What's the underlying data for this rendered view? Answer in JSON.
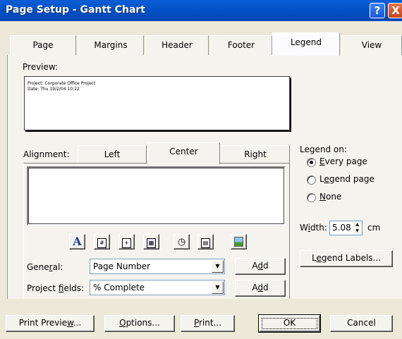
{
  "window": {
    "title": "Page Setup - Gantt Chart",
    "help_glyph": "?",
    "close_glyph": "X"
  },
  "tabs": [
    {
      "label": "Page"
    },
    {
      "label": "Margins"
    },
    {
      "label": "Header"
    },
    {
      "label": "Footer"
    },
    {
      "label": "Legend"
    },
    {
      "label": "View"
    }
  ],
  "preview": {
    "label": "Preview:",
    "lines": [
      "Project: Corporate Office Project",
      "Date: Thu 19/2/04 10:22"
    ]
  },
  "alignment": {
    "label": "Alignment:",
    "tabs": [
      {
        "label": "Left"
      },
      {
        "label": "Center"
      },
      {
        "label": "Right"
      }
    ]
  },
  "toolbar_icons": [
    "font-icon",
    "page-number-icon",
    "total-pages-icon",
    "date-icon",
    "time-icon",
    "file-name-icon",
    "picture-icon"
  ],
  "general": {
    "label_prefix": "Gene",
    "label_key": "r",
    "label_suffix": "al:",
    "value": "Page Number",
    "add_prefix": "A",
    "add_key": "d",
    "add_suffix": "d"
  },
  "project_fields": {
    "label_prefix": "Project ",
    "label_key": "f",
    "label_suffix": "ields:",
    "value": "% Complete",
    "add_prefix": "A",
    "add_key": "d",
    "add_suffix": "d"
  },
  "legend_on": {
    "label": "Legend on:",
    "options": [
      {
        "key": "E",
        "rest": "very page",
        "selected": true
      },
      {
        "key": "",
        "pre": "L",
        "rest_key": "e",
        "rest": "gend page",
        "selected": false
      },
      {
        "key": "N",
        "rest": "one",
        "selected": false
      }
    ]
  },
  "width": {
    "label_prefix": "W",
    "label_key": "i",
    "label_suffix": "dth:",
    "value": "5.08",
    "unit": "cm"
  },
  "legend_labels_button": {
    "prefix": "L",
    "key": "e",
    "suffix": "gend Labels..."
  },
  "footer_buttons": {
    "print_preview": {
      "prefix": "Print Previe",
      "key": "w",
      "suffix": "..."
    },
    "options": {
      "prefix": "",
      "key": "O",
      "suffix": "ptions..."
    },
    "print": {
      "prefix": "",
      "key": "P",
      "suffix": "rint..."
    },
    "ok": "OK",
    "cancel": "Cancel"
  }
}
